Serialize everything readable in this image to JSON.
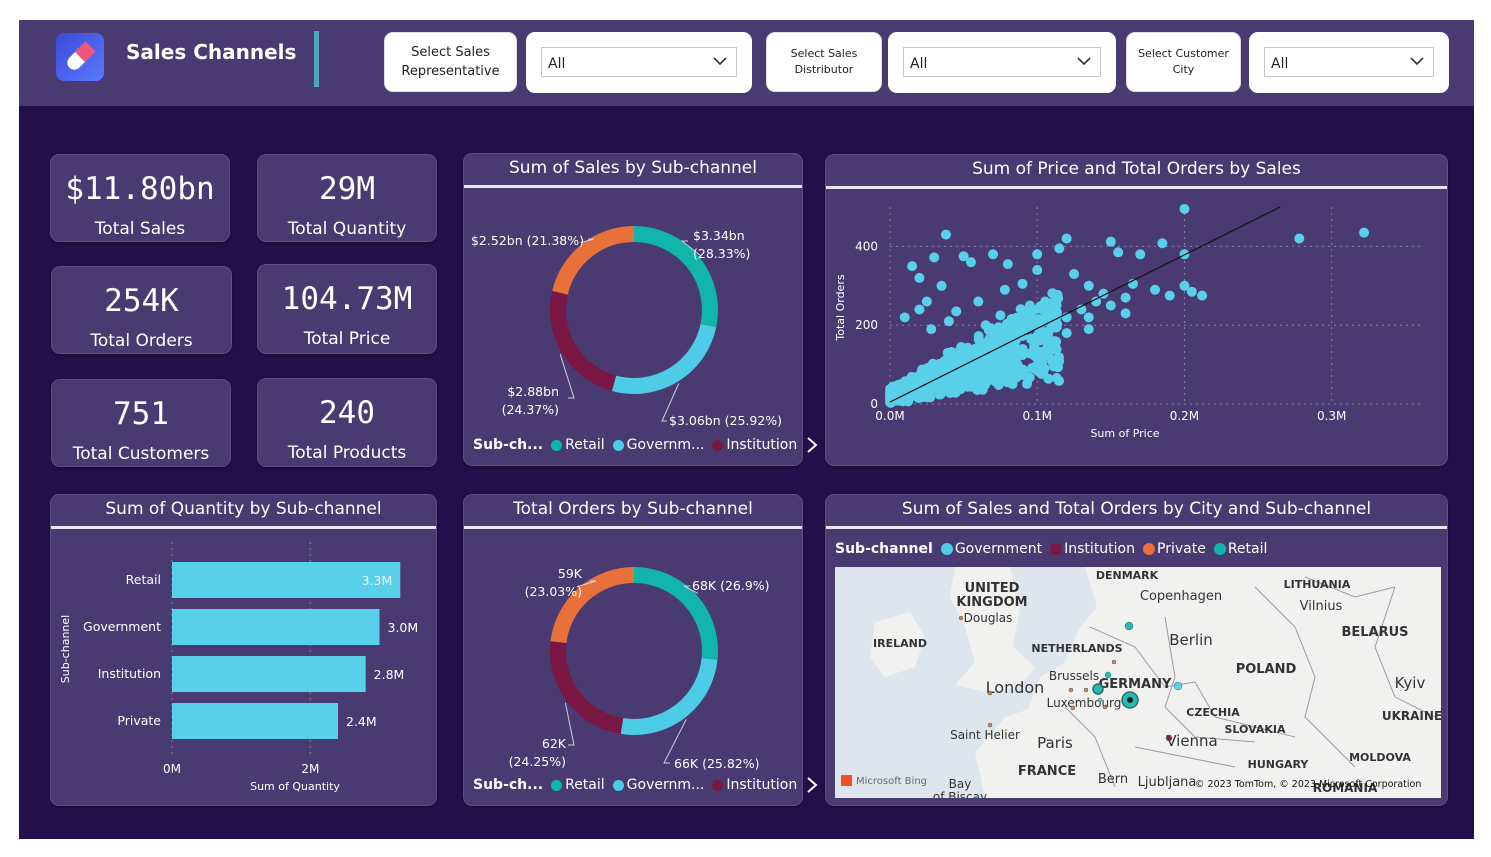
{
  "header": {
    "title": "Sales Channels",
    "slicers": [
      {
        "label": "Select Sales Representative",
        "value": "All"
      },
      {
        "label": "Select Sales Distributor",
        "value": "All"
      },
      {
        "label": "Select Customer City",
        "value": "All"
      }
    ]
  },
  "kpis": [
    {
      "value": "$11.80bn",
      "label": "Total Sales"
    },
    {
      "value": "29M",
      "label": "Total Quantity"
    },
    {
      "value": "254K",
      "label": "Total Orders"
    },
    {
      "value": "104.73M",
      "label": "Total Price"
    },
    {
      "value": "751",
      "label": "Total Customers"
    },
    {
      "value": "240",
      "label": "Total Products"
    }
  ],
  "colors": {
    "retail": "#12b5ab",
    "government": "#4ecbe6",
    "institution": "#7a1742",
    "private": "#e8703a",
    "bar": "#58d0ea",
    "panel": "#4a3a72",
    "background": "#22104a"
  },
  "chart_data": [
    {
      "type": "donut",
      "title": "Sum of Sales by Sub-channel",
      "slices": [
        {
          "name": "Retail",
          "value": 3.34,
          "share": 28.33,
          "label": "$3.34bn",
          "pct_label": "(28.33%)",
          "color": "#12b5ab"
        },
        {
          "name": "Government",
          "value": 3.06,
          "share": 25.92,
          "label": "$3.06bn (25.92%)",
          "pct_label": "",
          "color": "#4ecbe6"
        },
        {
          "name": "Institution",
          "value": 2.88,
          "share": 24.37,
          "label": "$2.88bn",
          "pct_label": "(24.37%)",
          "color": "#7a1742"
        },
        {
          "name": "Private",
          "value": 2.52,
          "share": 21.38,
          "label": "$2.52bn (21.38%)",
          "pct_label": "",
          "color": "#e8703a"
        }
      ],
      "legend": {
        "title": "Sub-ch...",
        "items": [
          "Retail",
          "Governm...",
          "Institution"
        ]
      }
    },
    {
      "type": "scatter",
      "title": "Sum of Price and Total Orders by Sales",
      "xlabel": "Sum of Price",
      "ylabel": "Total Orders",
      "x_ticks": [
        "0.0M",
        "0.1M",
        "0.2M",
        "0.3M"
      ],
      "y_ticks": [
        "0",
        "200",
        "400"
      ],
      "xlim": [
        0,
        0.36
      ],
      "ylim": [
        0,
        500
      ],
      "trend_line": [
        [
          0,
          5
        ],
        [
          0.265,
          500
        ]
      ],
      "points": [
        [
          0.2,
          495
        ],
        [
          0.322,
          435
        ],
        [
          0.278,
          420
        ],
        [
          0.038,
          430
        ],
        [
          0.12,
          420
        ],
        [
          0.15,
          412
        ],
        [
          0.185,
          408
        ],
        [
          0.2,
          380
        ],
        [
          0.115,
          395
        ],
        [
          0.155,
          385
        ],
        [
          0.05,
          375
        ],
        [
          0.07,
          380
        ],
        [
          0.1,
          380
        ],
        [
          0.17,
          380
        ],
        [
          0.015,
          350
        ],
        [
          0.03,
          372
        ],
        [
          0.055,
          360
        ],
        [
          0.08,
          355
        ],
        [
          0.1,
          340
        ],
        [
          0.125,
          330
        ],
        [
          0.2,
          300
        ],
        [
          0.205,
          285
        ],
        [
          0.212,
          275
        ],
        [
          0.18,
          290
        ],
        [
          0.19,
          275
        ],
        [
          0.165,
          305
        ],
        [
          0.16,
          270
        ],
        [
          0.135,
          300
        ],
        [
          0.145,
          280
        ],
        [
          0.14,
          260
        ],
        [
          0.15,
          250
        ],
        [
          0.13,
          240
        ],
        [
          0.12,
          220
        ],
        [
          0.108,
          235
        ],
        [
          0.095,
          250
        ],
        [
          0.075,
          225
        ],
        [
          0.11,
          210
        ],
        [
          0.135,
          220
        ],
        [
          0.16,
          230
        ],
        [
          0.135,
          190
        ],
        [
          0.12,
          180
        ],
        [
          0.105,
          170
        ],
        [
          0.085,
          160
        ],
        [
          0.06,
          260
        ],
        [
          0.045,
          235
        ],
        [
          0.035,
          300
        ],
        [
          0.02,
          320
        ],
        [
          0.025,
          260
        ],
        [
          0.04,
          210
        ],
        [
          0.065,
          200
        ],
        [
          0.078,
          290
        ],
        [
          0.09,
          305
        ],
        [
          0.02,
          240
        ],
        [
          0.01,
          220
        ],
        [
          0.028,
          190
        ]
      ],
      "dense_region": "many points between x 0.0M-0.12M and y 0-300"
    },
    {
      "type": "bar",
      "title": "Sum of Quantity by Sub-channel",
      "xlabel": "Sum of Quantity",
      "ylabel": "Sub-channel",
      "categories": [
        "Retail",
        "Government",
        "Institution",
        "Private"
      ],
      "values": [
        3.3,
        3.0,
        2.8,
        2.4
      ],
      "value_labels": [
        "3.3M",
        "3.0M",
        "2.8M",
        "2.4M"
      ],
      "x_ticks": [
        "0M",
        "2M"
      ],
      "xlim": [
        0,
        3.6
      ]
    },
    {
      "type": "donut",
      "title": "Total Orders by Sub-channel",
      "slices": [
        {
          "name": "Retail",
          "value": 68,
          "share": 26.9,
          "label": "68K (26.9%)",
          "pct_label": "",
          "color": "#12b5ab"
        },
        {
          "name": "Government",
          "value": 66,
          "share": 25.82,
          "label": "66K (25.82%)",
          "pct_label": "",
          "color": "#4ecbe6"
        },
        {
          "name": "Institution",
          "value": 62,
          "share": 24.25,
          "label": "62K",
          "pct_label": "(24.25%)",
          "color": "#7a1742"
        },
        {
          "name": "Private",
          "value": 59,
          "share": 23.03,
          "label": "59K",
          "pct_label": "(23.03%)",
          "color": "#e8703a"
        }
      ],
      "legend": {
        "title": "Sub-ch...",
        "items": [
          "Retail",
          "Governm...",
          "Institution"
        ]
      }
    }
  ],
  "map": {
    "title": "Sum of Sales and Total Orders by City and Sub-channel",
    "legend_title": "Sub-channel",
    "legend_items": [
      {
        "name": "Government",
        "color": "#4ecbe6"
      },
      {
        "name": "Institution",
        "color": "#7a1742"
      },
      {
        "name": "Private",
        "color": "#e8703a"
      },
      {
        "name": "Retail",
        "color": "#12b5ab"
      }
    ],
    "place_labels": [
      "DENMARK",
      "LITHUANIA",
      "UNITED KINGDOM",
      "Copenhagen",
      "Vilnius",
      "Douglas",
      "BELARUS",
      "IRELAND",
      "NETHERLANDS",
      "Berlin",
      "POLAND",
      "Brussels",
      "GERMANY",
      "London",
      "Kyiv",
      "Luxembourg",
      "UKRAINE",
      "CZECHIA",
      "SLOVAKIA",
      "Saint Helier",
      "Paris",
      "Vienna",
      "MOLDOVA",
      "FRANCE",
      "HUNGARY",
      "Bern",
      "Ljubljana",
      "ROMANIA",
      "Bay of Biscay"
    ],
    "attribution": "© 2023 TomTom, © 2023 Microsoft Corporation",
    "provider": "Microsoft Bing"
  }
}
